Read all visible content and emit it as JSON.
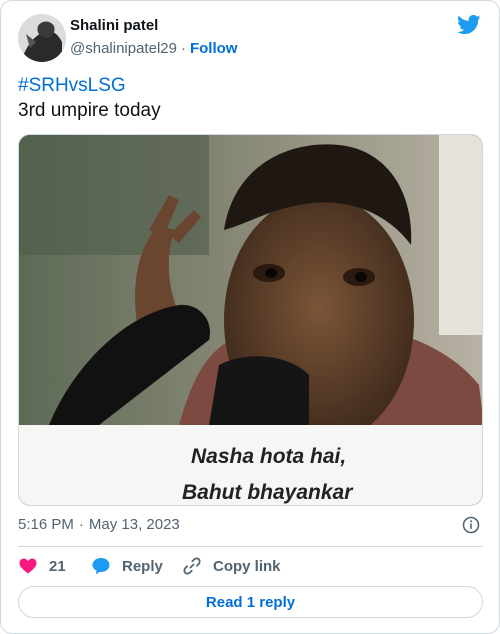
{
  "author": {
    "name": "Shalini patel",
    "handle": "@shalinipatel29",
    "separator": "·",
    "follow_label": "Follow"
  },
  "tweet": {
    "hashtag": "#SRHvsLSG",
    "text": "3rd umpire today"
  },
  "media": {
    "caption_line1": "Nasha hota hai,",
    "caption_line2": "Bahut bhayankar"
  },
  "meta": {
    "time": "5:16 PM",
    "separator": "·",
    "date": "May 13, 2023"
  },
  "actions": {
    "like_count": "21",
    "reply_label": "Reply",
    "copy_label": "Copy link"
  },
  "footer": {
    "read_replies_label": "Read 1 reply"
  },
  "colors": {
    "accent": "#006fd6",
    "like": "#f91880",
    "twitter": "#1d9bf0",
    "muted": "#536471"
  },
  "icons": {
    "brand": "twitter-bird-icon",
    "info": "info-icon",
    "like": "heart-icon",
    "reply": "speech-bubble-icon",
    "copy": "link-icon"
  }
}
